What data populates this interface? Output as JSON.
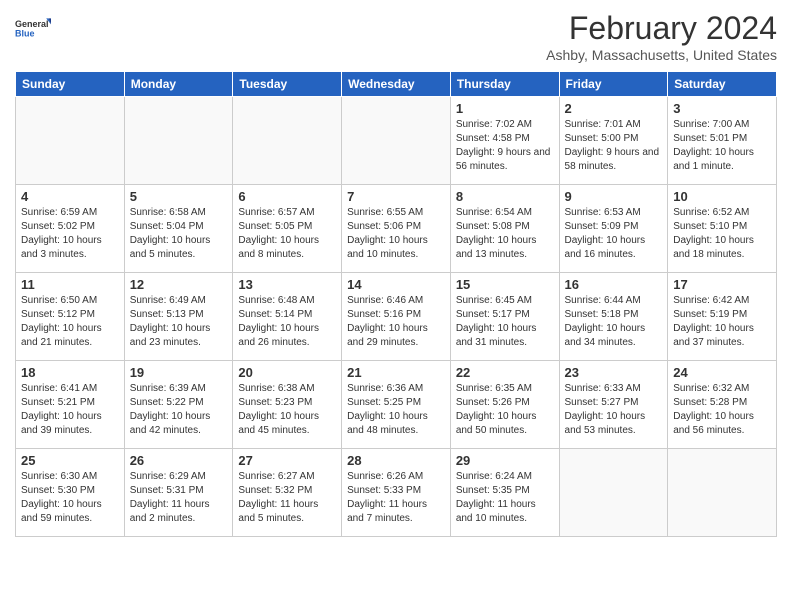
{
  "logo": {
    "text_general": "General",
    "text_blue": "Blue"
  },
  "title": "February 2024",
  "subtitle": "Ashby, Massachusetts, United States",
  "headers": [
    "Sunday",
    "Monday",
    "Tuesday",
    "Wednesday",
    "Thursday",
    "Friday",
    "Saturday"
  ],
  "weeks": [
    [
      {
        "day": "",
        "info": ""
      },
      {
        "day": "",
        "info": ""
      },
      {
        "day": "",
        "info": ""
      },
      {
        "day": "",
        "info": ""
      },
      {
        "day": "1",
        "info": "Sunrise: 7:02 AM\nSunset: 4:58 PM\nDaylight: 9 hours\nand 56 minutes."
      },
      {
        "day": "2",
        "info": "Sunrise: 7:01 AM\nSunset: 5:00 PM\nDaylight: 9 hours\nand 58 minutes."
      },
      {
        "day": "3",
        "info": "Sunrise: 7:00 AM\nSunset: 5:01 PM\nDaylight: 10 hours\nand 1 minute."
      }
    ],
    [
      {
        "day": "4",
        "info": "Sunrise: 6:59 AM\nSunset: 5:02 PM\nDaylight: 10 hours\nand 3 minutes."
      },
      {
        "day": "5",
        "info": "Sunrise: 6:58 AM\nSunset: 5:04 PM\nDaylight: 10 hours\nand 5 minutes."
      },
      {
        "day": "6",
        "info": "Sunrise: 6:57 AM\nSunset: 5:05 PM\nDaylight: 10 hours\nand 8 minutes."
      },
      {
        "day": "7",
        "info": "Sunrise: 6:55 AM\nSunset: 5:06 PM\nDaylight: 10 hours\nand 10 minutes."
      },
      {
        "day": "8",
        "info": "Sunrise: 6:54 AM\nSunset: 5:08 PM\nDaylight: 10 hours\nand 13 minutes."
      },
      {
        "day": "9",
        "info": "Sunrise: 6:53 AM\nSunset: 5:09 PM\nDaylight: 10 hours\nand 16 minutes."
      },
      {
        "day": "10",
        "info": "Sunrise: 6:52 AM\nSunset: 5:10 PM\nDaylight: 10 hours\nand 18 minutes."
      }
    ],
    [
      {
        "day": "11",
        "info": "Sunrise: 6:50 AM\nSunset: 5:12 PM\nDaylight: 10 hours\nand 21 minutes."
      },
      {
        "day": "12",
        "info": "Sunrise: 6:49 AM\nSunset: 5:13 PM\nDaylight: 10 hours\nand 23 minutes."
      },
      {
        "day": "13",
        "info": "Sunrise: 6:48 AM\nSunset: 5:14 PM\nDaylight: 10 hours\nand 26 minutes."
      },
      {
        "day": "14",
        "info": "Sunrise: 6:46 AM\nSunset: 5:16 PM\nDaylight: 10 hours\nand 29 minutes."
      },
      {
        "day": "15",
        "info": "Sunrise: 6:45 AM\nSunset: 5:17 PM\nDaylight: 10 hours\nand 31 minutes."
      },
      {
        "day": "16",
        "info": "Sunrise: 6:44 AM\nSunset: 5:18 PM\nDaylight: 10 hours\nand 34 minutes."
      },
      {
        "day": "17",
        "info": "Sunrise: 6:42 AM\nSunset: 5:19 PM\nDaylight: 10 hours\nand 37 minutes."
      }
    ],
    [
      {
        "day": "18",
        "info": "Sunrise: 6:41 AM\nSunset: 5:21 PM\nDaylight: 10 hours\nand 39 minutes."
      },
      {
        "day": "19",
        "info": "Sunrise: 6:39 AM\nSunset: 5:22 PM\nDaylight: 10 hours\nand 42 minutes."
      },
      {
        "day": "20",
        "info": "Sunrise: 6:38 AM\nSunset: 5:23 PM\nDaylight: 10 hours\nand 45 minutes."
      },
      {
        "day": "21",
        "info": "Sunrise: 6:36 AM\nSunset: 5:25 PM\nDaylight: 10 hours\nand 48 minutes."
      },
      {
        "day": "22",
        "info": "Sunrise: 6:35 AM\nSunset: 5:26 PM\nDaylight: 10 hours\nand 50 minutes."
      },
      {
        "day": "23",
        "info": "Sunrise: 6:33 AM\nSunset: 5:27 PM\nDaylight: 10 hours\nand 53 minutes."
      },
      {
        "day": "24",
        "info": "Sunrise: 6:32 AM\nSunset: 5:28 PM\nDaylight: 10 hours\nand 56 minutes."
      }
    ],
    [
      {
        "day": "25",
        "info": "Sunrise: 6:30 AM\nSunset: 5:30 PM\nDaylight: 10 hours\nand 59 minutes."
      },
      {
        "day": "26",
        "info": "Sunrise: 6:29 AM\nSunset: 5:31 PM\nDaylight: 11 hours\nand 2 minutes."
      },
      {
        "day": "27",
        "info": "Sunrise: 6:27 AM\nSunset: 5:32 PM\nDaylight: 11 hours\nand 5 minutes."
      },
      {
        "day": "28",
        "info": "Sunrise: 6:26 AM\nSunset: 5:33 PM\nDaylight: 11 hours\nand 7 minutes."
      },
      {
        "day": "29",
        "info": "Sunrise: 6:24 AM\nSunset: 5:35 PM\nDaylight: 11 hours\nand 10 minutes."
      },
      {
        "day": "",
        "info": ""
      },
      {
        "day": "",
        "info": ""
      }
    ]
  ]
}
